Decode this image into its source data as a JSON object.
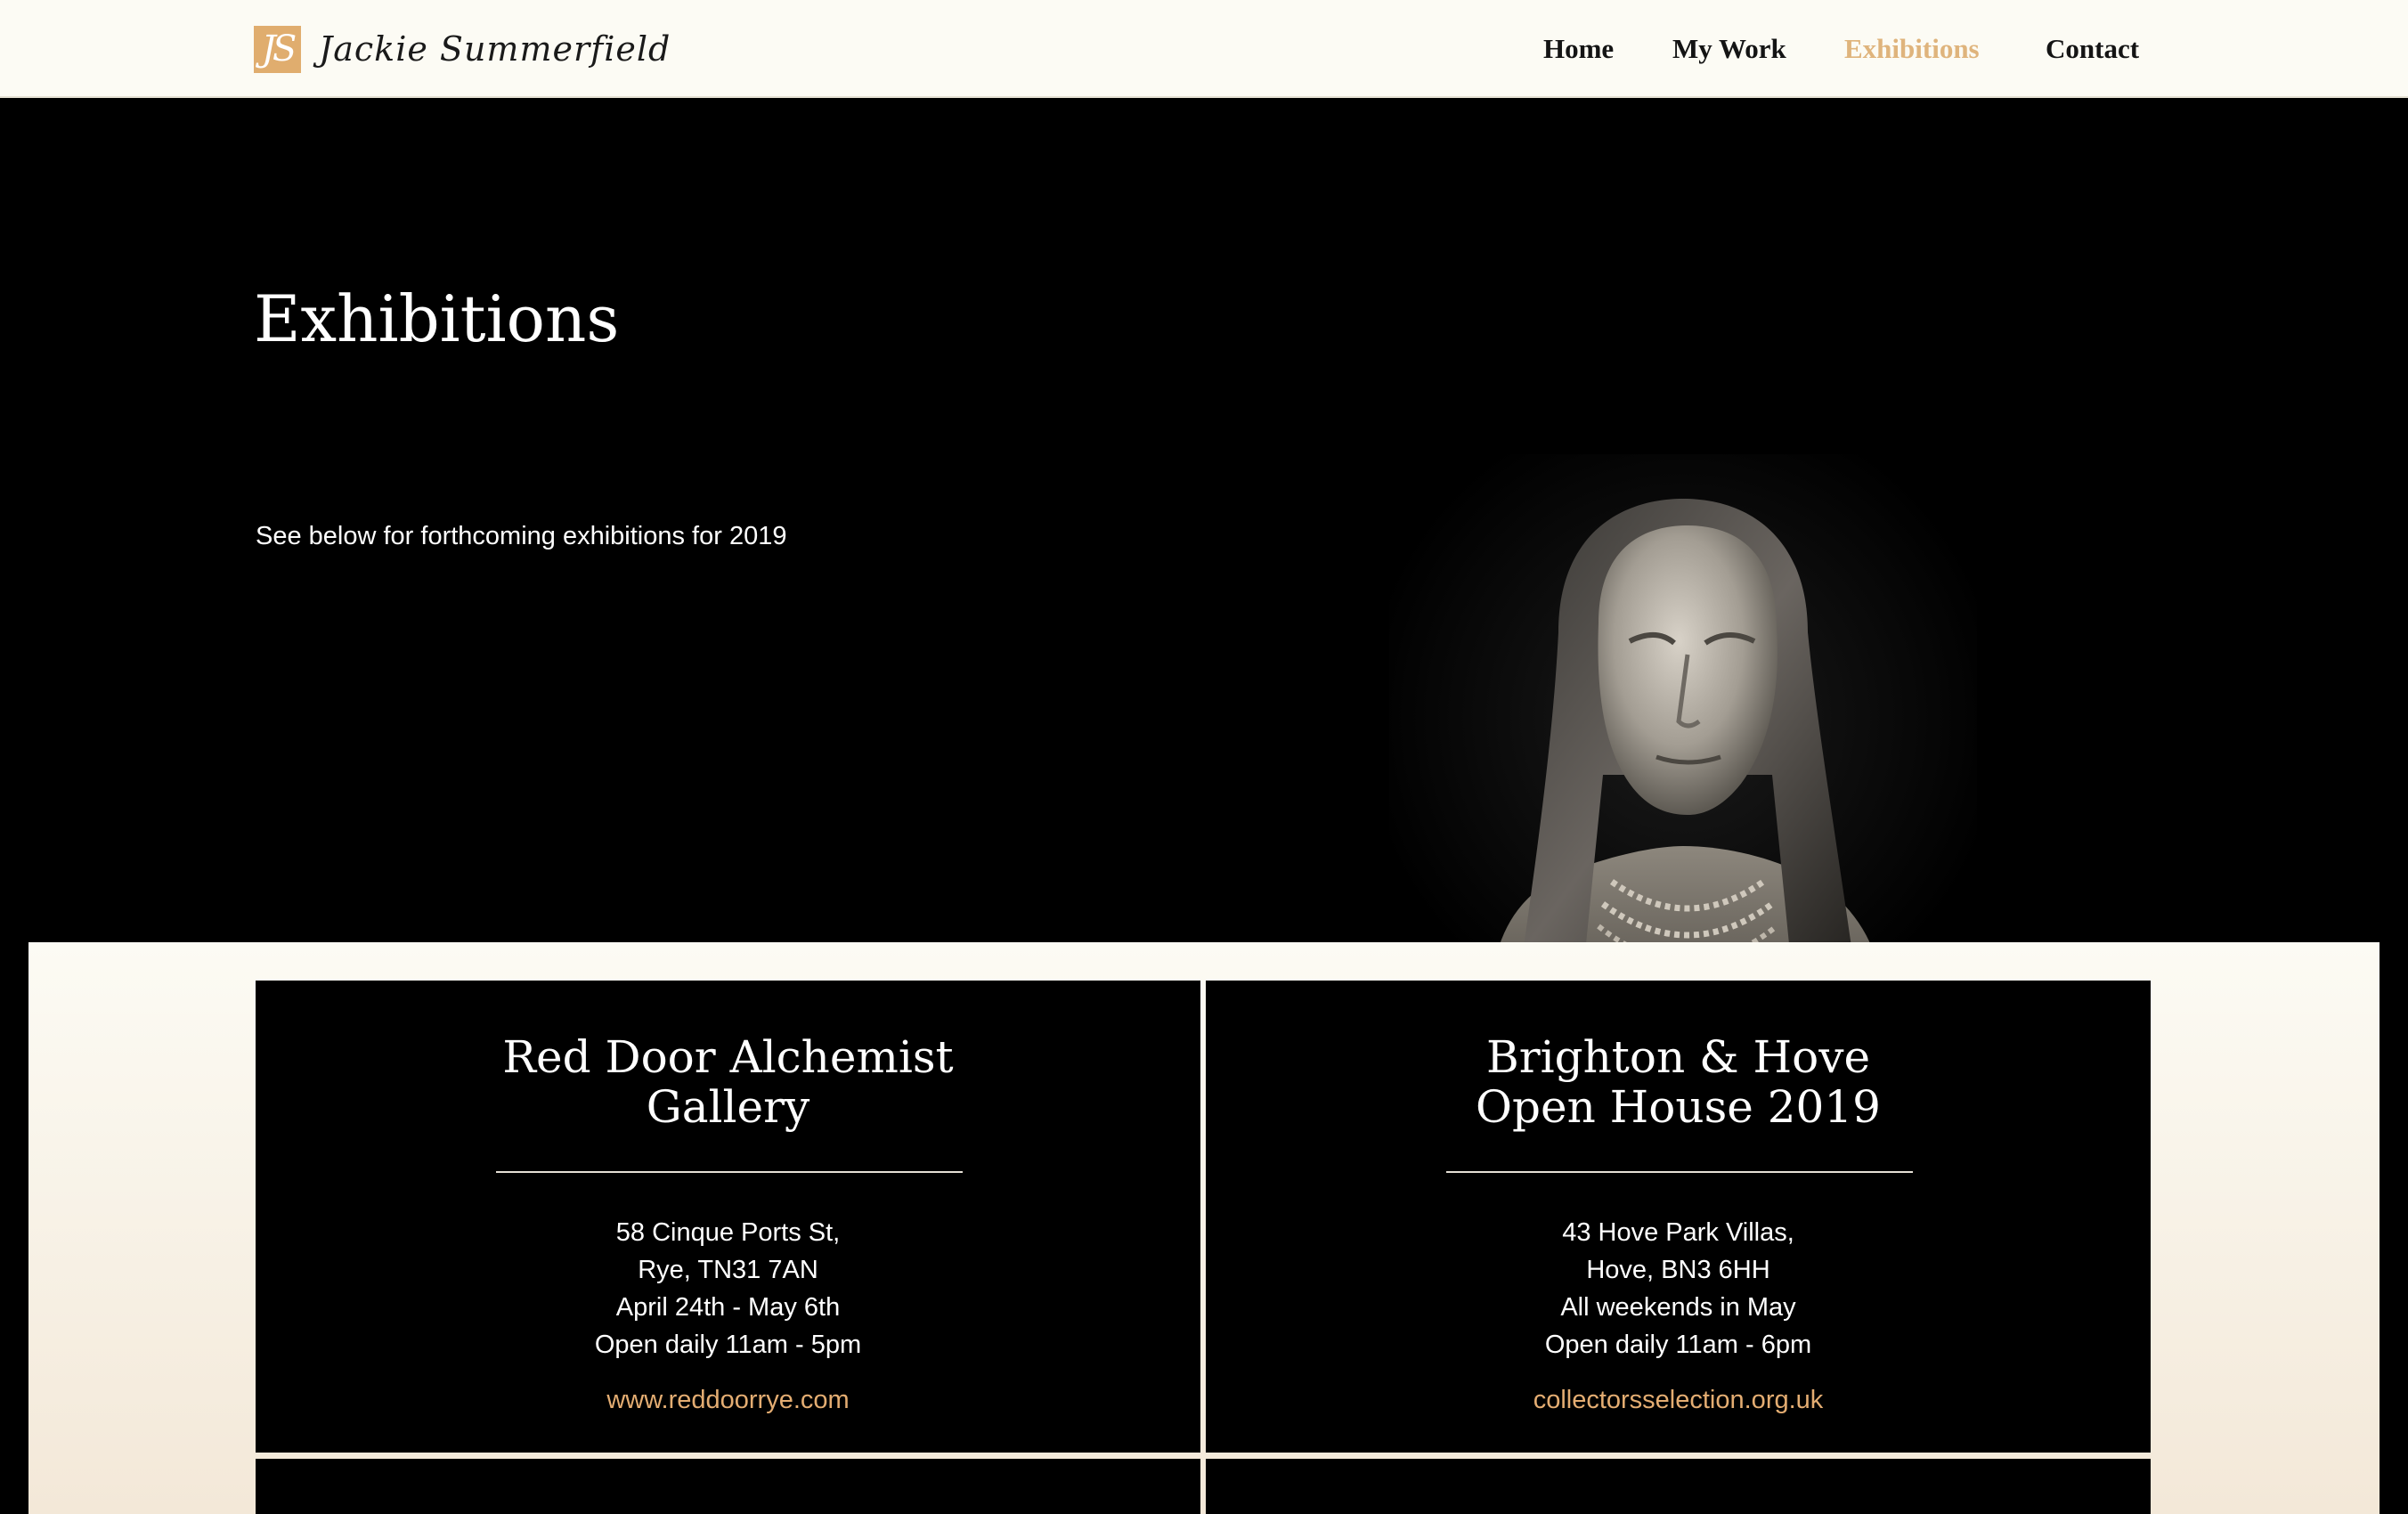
{
  "brand": {
    "logo_mark": "JS",
    "name": "Jackie Summerfield",
    "accent_color": "#e0ad6e"
  },
  "nav": {
    "items": [
      {
        "label": "Home",
        "active": false
      },
      {
        "label": "My Work",
        "active": false
      },
      {
        "label": "Exhibitions",
        "active": true
      },
      {
        "label": "Contact",
        "active": false
      }
    ]
  },
  "hero": {
    "title": "Exhibitions",
    "subtitle": "See below for forthcoming exhibitions for 2019",
    "image": "sculpture-bust"
  },
  "exhibitions": [
    {
      "title_lines": [
        "Red Door Alchemist",
        "Gallery"
      ],
      "lines": [
        "58 Cinque Ports St,",
        "Rye, TN31 7AN",
        "April 24th - May 6th",
        "Open daily 11am - 5pm"
      ],
      "link": "www.reddoorrye.com"
    },
    {
      "title_lines": [
        "Brighton & Hove",
        "Open House 2019"
      ],
      "lines": [
        "43 Hove Park Villas,",
        "Hove, BN3 6HH",
        "All weekends in May",
        "Open daily 11am - 6pm"
      ],
      "link": "collectorsselection.org.uk"
    }
  ]
}
